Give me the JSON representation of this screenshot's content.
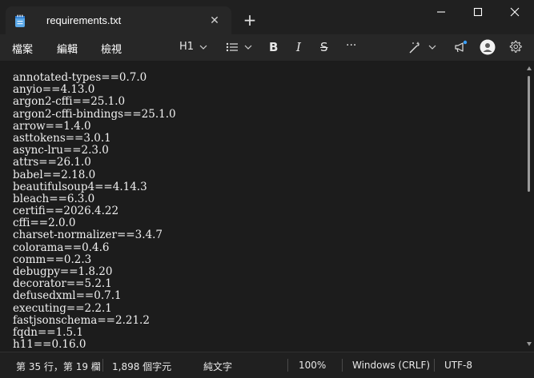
{
  "tab": {
    "title": "requirements.txt",
    "close": "✕"
  },
  "new_tab": "+",
  "menu": {
    "file": "檔案",
    "edit": "編輯",
    "view": "檢視"
  },
  "toolbar": {
    "heading": "H1",
    "bold": "B",
    "italic": "I",
    "strike": "S",
    "more": "···"
  },
  "editor": {
    "lines": [
      "annotated-types==0.7.0",
      "anyio==4.13.0",
      "argon2-cffi==25.1.0",
      "argon2-cffi-bindings==25.1.0",
      "arrow==1.4.0",
      "asttokens==3.0.1",
      "async-lru==2.3.0",
      "attrs==26.1.0",
      "babel==2.18.0",
      "beautifulsoup4==4.14.3",
      "bleach==6.3.0",
      "certifi==2026.4.22",
      "cffi==2.0.0",
      "charset-normalizer==3.4.7",
      "colorama==0.4.6",
      "comm==0.2.3",
      "debugpy==1.8.20",
      "decorator==5.2.1",
      "defusedxml==0.7.1",
      "executing==2.2.1",
      "fastjsonschema==2.21.2",
      "fqdn==1.5.1",
      "h11==0.16.0"
    ]
  },
  "status": {
    "position": "第 35 行，第 19 欄",
    "chars": "1,898 個字元",
    "format": "純文字",
    "zoom": "100%",
    "line_ending": "Windows (CRLF)",
    "encoding": "UTF-8"
  }
}
